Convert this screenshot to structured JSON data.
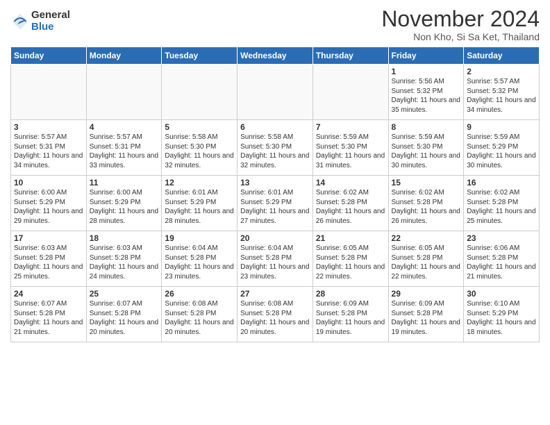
{
  "logo": {
    "general": "General",
    "blue": "Blue"
  },
  "header": {
    "month": "November 2024",
    "location": "Non Kho, Si Sa Ket, Thailand"
  },
  "weekdays": [
    "Sunday",
    "Monday",
    "Tuesday",
    "Wednesday",
    "Thursday",
    "Friday",
    "Saturday"
  ],
  "weeks": [
    [
      {
        "day": "",
        "info": ""
      },
      {
        "day": "",
        "info": ""
      },
      {
        "day": "",
        "info": ""
      },
      {
        "day": "",
        "info": ""
      },
      {
        "day": "",
        "info": ""
      },
      {
        "day": "1",
        "info": "Sunrise: 5:56 AM\nSunset: 5:32 PM\nDaylight: 11 hours\nand 35 minutes."
      },
      {
        "day": "2",
        "info": "Sunrise: 5:57 AM\nSunset: 5:32 PM\nDaylight: 11 hours\nand 34 minutes."
      }
    ],
    [
      {
        "day": "3",
        "info": "Sunrise: 5:57 AM\nSunset: 5:31 PM\nDaylight: 11 hours\nand 34 minutes."
      },
      {
        "day": "4",
        "info": "Sunrise: 5:57 AM\nSunset: 5:31 PM\nDaylight: 11 hours\nand 33 minutes."
      },
      {
        "day": "5",
        "info": "Sunrise: 5:58 AM\nSunset: 5:30 PM\nDaylight: 11 hours\nand 32 minutes."
      },
      {
        "day": "6",
        "info": "Sunrise: 5:58 AM\nSunset: 5:30 PM\nDaylight: 11 hours\nand 32 minutes."
      },
      {
        "day": "7",
        "info": "Sunrise: 5:59 AM\nSunset: 5:30 PM\nDaylight: 11 hours\nand 31 minutes."
      },
      {
        "day": "8",
        "info": "Sunrise: 5:59 AM\nSunset: 5:30 PM\nDaylight: 11 hours\nand 30 minutes."
      },
      {
        "day": "9",
        "info": "Sunrise: 5:59 AM\nSunset: 5:29 PM\nDaylight: 11 hours\nand 30 minutes."
      }
    ],
    [
      {
        "day": "10",
        "info": "Sunrise: 6:00 AM\nSunset: 5:29 PM\nDaylight: 11 hours\nand 29 minutes."
      },
      {
        "day": "11",
        "info": "Sunrise: 6:00 AM\nSunset: 5:29 PM\nDaylight: 11 hours\nand 28 minutes."
      },
      {
        "day": "12",
        "info": "Sunrise: 6:01 AM\nSunset: 5:29 PM\nDaylight: 11 hours\nand 28 minutes."
      },
      {
        "day": "13",
        "info": "Sunrise: 6:01 AM\nSunset: 5:29 PM\nDaylight: 11 hours\nand 27 minutes."
      },
      {
        "day": "14",
        "info": "Sunrise: 6:02 AM\nSunset: 5:28 PM\nDaylight: 11 hours\nand 26 minutes."
      },
      {
        "day": "15",
        "info": "Sunrise: 6:02 AM\nSunset: 5:28 PM\nDaylight: 11 hours\nand 26 minutes."
      },
      {
        "day": "16",
        "info": "Sunrise: 6:02 AM\nSunset: 5:28 PM\nDaylight: 11 hours\nand 25 minutes."
      }
    ],
    [
      {
        "day": "17",
        "info": "Sunrise: 6:03 AM\nSunset: 5:28 PM\nDaylight: 11 hours\nand 25 minutes."
      },
      {
        "day": "18",
        "info": "Sunrise: 6:03 AM\nSunset: 5:28 PM\nDaylight: 11 hours\nand 24 minutes."
      },
      {
        "day": "19",
        "info": "Sunrise: 6:04 AM\nSunset: 5:28 PM\nDaylight: 11 hours\nand 23 minutes."
      },
      {
        "day": "20",
        "info": "Sunrise: 6:04 AM\nSunset: 5:28 PM\nDaylight: 11 hours\nand 23 minutes."
      },
      {
        "day": "21",
        "info": "Sunrise: 6:05 AM\nSunset: 5:28 PM\nDaylight: 11 hours\nand 22 minutes."
      },
      {
        "day": "22",
        "info": "Sunrise: 6:05 AM\nSunset: 5:28 PM\nDaylight: 11 hours\nand 22 minutes."
      },
      {
        "day": "23",
        "info": "Sunrise: 6:06 AM\nSunset: 5:28 PM\nDaylight: 11 hours\nand 21 minutes."
      }
    ],
    [
      {
        "day": "24",
        "info": "Sunrise: 6:07 AM\nSunset: 5:28 PM\nDaylight: 11 hours\nand 21 minutes."
      },
      {
        "day": "25",
        "info": "Sunrise: 6:07 AM\nSunset: 5:28 PM\nDaylight: 11 hours\nand 20 minutes."
      },
      {
        "day": "26",
        "info": "Sunrise: 6:08 AM\nSunset: 5:28 PM\nDaylight: 11 hours\nand 20 minutes."
      },
      {
        "day": "27",
        "info": "Sunrise: 6:08 AM\nSunset: 5:28 PM\nDaylight: 11 hours\nand 20 minutes."
      },
      {
        "day": "28",
        "info": "Sunrise: 6:09 AM\nSunset: 5:28 PM\nDaylight: 11 hours\nand 19 minutes."
      },
      {
        "day": "29",
        "info": "Sunrise: 6:09 AM\nSunset: 5:28 PM\nDaylight: 11 hours\nand 19 minutes."
      },
      {
        "day": "30",
        "info": "Sunrise: 6:10 AM\nSunset: 5:29 PM\nDaylight: 11 hours\nand 18 minutes."
      }
    ]
  ]
}
